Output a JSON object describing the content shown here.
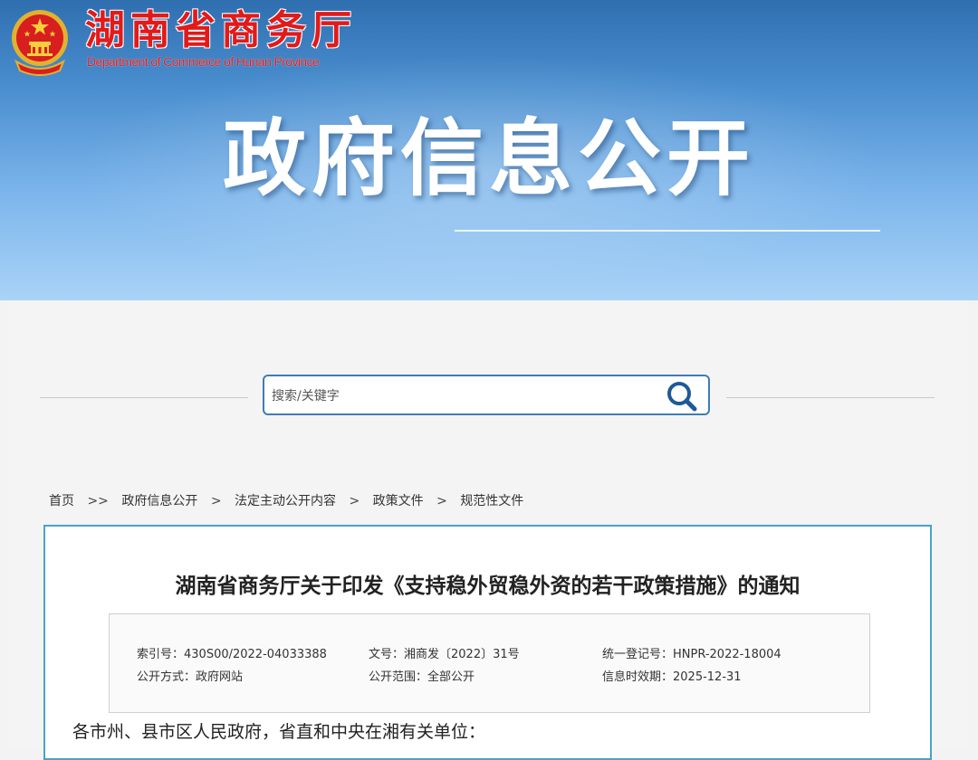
{
  "header": {
    "org_name_cn": "湖南省商务厅",
    "org_name_en": "Department of Commerce of Hunan Province",
    "section_title": "政府信息公开"
  },
  "search": {
    "placeholder": "搜索/关键字",
    "icon": "search-icon"
  },
  "breadcrumb": {
    "items": [
      "首页",
      "政府信息公开",
      "法定主动公开内容",
      "政策文件",
      "规范性文件"
    ],
    "separators": [
      ">>",
      ">",
      ">",
      ">"
    ]
  },
  "document": {
    "title": "湖南省商务厅关于印发《支持稳外贸稳外资的若干政策措施》的通知",
    "meta": {
      "index_no": "索引号：430S00/2022-04033388",
      "doc_no": "文号：湘商发〔2022〕31号",
      "reg_no": "统一登记号：HNPR-2022-18004",
      "publish_method": "公开方式：政府网站",
      "publish_scope": "公开范围：全部公开",
      "valid_until": "信息时效期：2025-12-31"
    },
    "salutation": "各市州、县市区人民政府，省直和中央在湘有关单位："
  },
  "colors": {
    "brand_red": "#e21a1a",
    "banner_top": "#2f6fb0",
    "banner_bottom": "#a9d3f7",
    "search_border": "#3f7cb8",
    "doc_border": "#4aa3c4"
  }
}
